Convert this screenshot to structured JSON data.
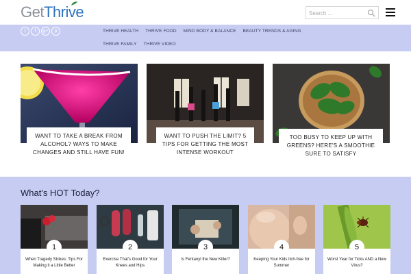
{
  "header": {
    "logo_get": "Get",
    "logo_thrive": "Thrive",
    "search_placeholder": "Search ...",
    "icons": [
      "search-icon",
      "hamburger-menu-icon",
      "leaf-icon"
    ]
  },
  "social": [
    {
      "name": "twitter",
      "glyph": "t"
    },
    {
      "name": "facebook",
      "glyph": "f"
    },
    {
      "name": "google-plus",
      "glyph": "g+"
    },
    {
      "name": "pinterest",
      "glyph": "p"
    }
  ],
  "nav": {
    "row1": [
      "THRIVE HEALTH",
      "THRIVE FOOD",
      "MIND BODY & BALANCE",
      "BEAUTY TRENDS & AGING"
    ],
    "row2": [
      "THRIVE FAMILY",
      "THRIVE VIDEO"
    ]
  },
  "featured": [
    {
      "title": "WANT TO TAKE A BREAK FROM ALCOHOL? WAYS TO MAKE CHANGES AND STILL HAVE FUN!"
    },
    {
      "title": "WANT TO PUSH THE LIMIT? 5 TIPS FOR GETTING THE MOST INTENSE WORKOUT"
    },
    {
      "title": "TOO BUSY TO KEEP UP WITH GREENS? HERE'S A SMOOTHIE SURE TO SATISFY"
    }
  ],
  "hot": {
    "title": "What's HOT Today?",
    "items": [
      {
        "number": "1",
        "title": "When Tragedy Strikes: Tips For Making it a Little Better"
      },
      {
        "number": "2",
        "title": "Exercise That's Good for Your Knees and Hips"
      },
      {
        "number": "3",
        "title": "Is Fentanyl the New Killer?"
      },
      {
        "number": "4",
        "title": "Keeping Your Kids Itch-free for Summer"
      },
      {
        "number": "5",
        "title": "Worst Year for Ticks AND a New Virus?"
      }
    ]
  },
  "colors": {
    "brand_blue": "#2f74c0",
    "logo_gray": "#8a8f99",
    "band_lavender": "#c7ccf2",
    "nav_text": "#3a3f64"
  }
}
